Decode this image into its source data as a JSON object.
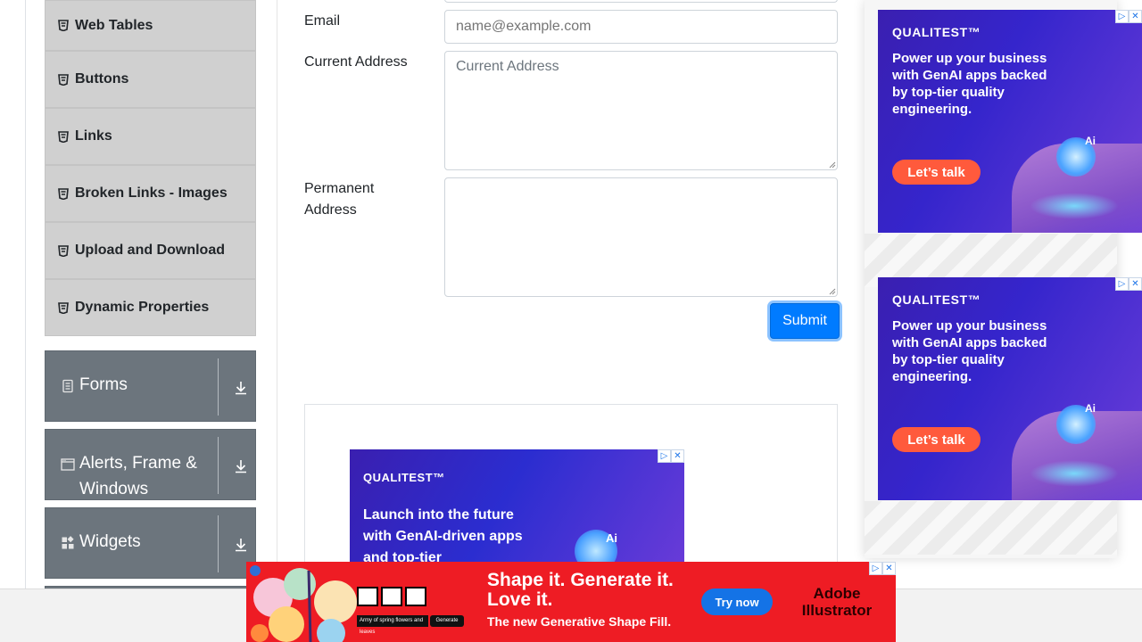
{
  "sidebar": {
    "elements_items": [
      {
        "label": "Web Tables"
      },
      {
        "label": "Buttons"
      },
      {
        "label": "Links"
      },
      {
        "label": "Broken Links - Images"
      },
      {
        "label": "Upload and Download"
      },
      {
        "label": "Dynamic Properties"
      }
    ],
    "groups": [
      {
        "label": "Forms",
        "icon": "form-icon"
      },
      {
        "label": "Alerts, Frame & Windows",
        "icon": "window-icon"
      },
      {
        "label": "Widgets",
        "icon": "widgets-icon"
      }
    ]
  },
  "form": {
    "email_label": "Email",
    "email_placeholder": "name@example.com",
    "current_address_label": "Current Address",
    "current_address_placeholder": "Current Address",
    "permanent_address_label": "Permanent Address",
    "submit_label": "Submit"
  },
  "ads": {
    "brand": "QUALITEST™",
    "side_copy": "Power up your business with GenAI apps backed by top-tier quality engineering.",
    "side_cta": "Let’s talk",
    "inline_copy": "Launch into the future with GenAI-driven apps and top-tier",
    "ai_badge": "Ai",
    "bottom_headline": "Shape it. Generate it. Love it.",
    "bottom_sub": "The new Generative Shape Fill.",
    "bottom_cta": "Try now",
    "bottom_brand": "Adobe Illustrator",
    "bottom_prompt": "Army of spring flowers and leaves",
    "bottom_generate": "Generate",
    "adchoices_glyph": "▷",
    "close_glyph": "✕"
  },
  "colors": {
    "primary": "#007bff",
    "group_bg": "#6c757d",
    "item_bg": "#d0d0d0",
    "ad_red": "#ee1c24",
    "ad_cta": "#ff5a3c"
  }
}
